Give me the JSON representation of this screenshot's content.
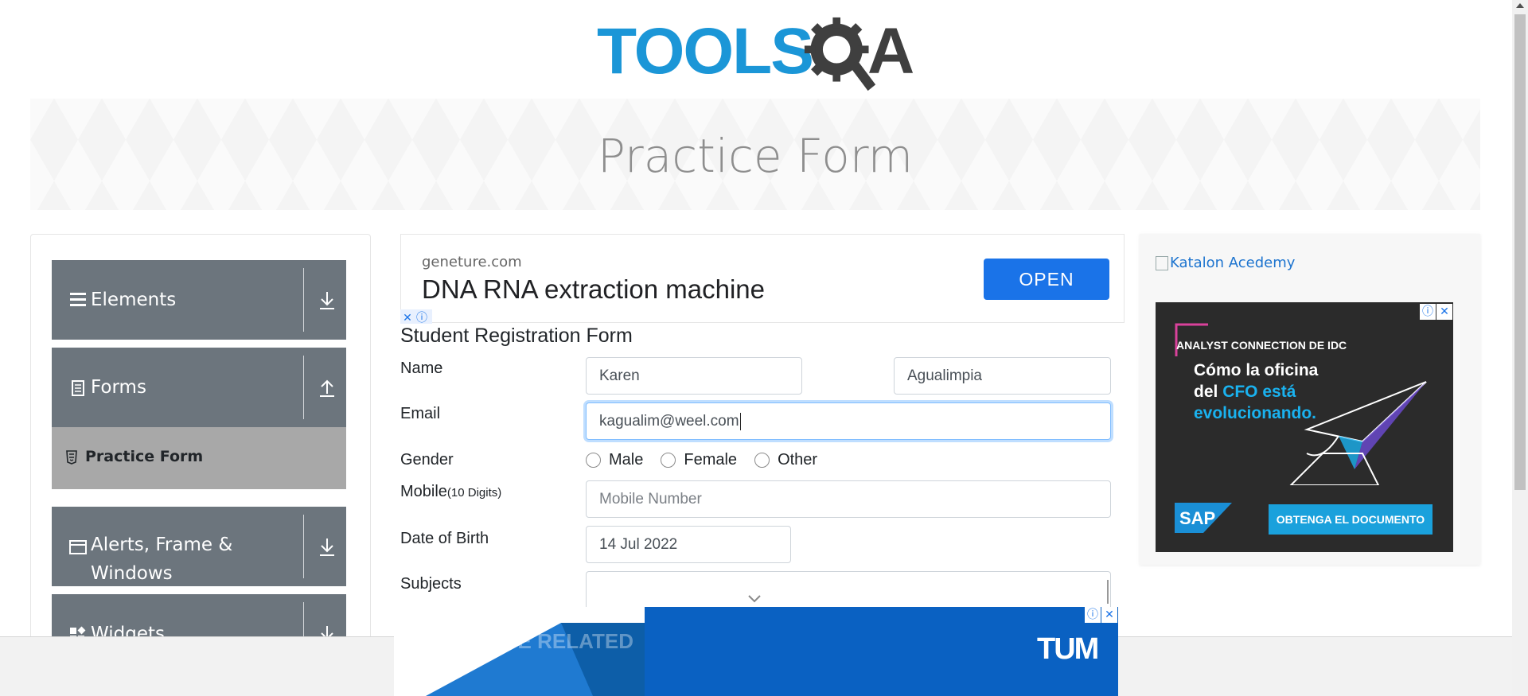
{
  "logo": {
    "brand_left": "TOOLS",
    "brand_right": "A"
  },
  "banner": {
    "title": "Practice Form"
  },
  "sidebar": {
    "groups": [
      {
        "label": "Elements",
        "icon": "menu-lines-icon",
        "arrow": "download-arrow-icon"
      },
      {
        "label": "Forms",
        "icon": "document-icon",
        "arrow": "upload-arrow-icon"
      },
      {
        "label": "Alerts, Frame & Windows",
        "icon": "window-icon",
        "arrow": "download-arrow-icon"
      },
      {
        "label": "Widgets",
        "icon": "widgets-icon",
        "arrow": "download-arrow-icon"
      }
    ],
    "active_item": {
      "label": "Practice Form",
      "icon": "html5-icon"
    }
  },
  "top_ad": {
    "domain": "geneture.com",
    "headline": "DNA RNA extraction machine",
    "cta": "OPEN",
    "badge_close": "✕",
    "badge_info": "ⓘ"
  },
  "form": {
    "title": "Student Registration Form",
    "name_label": "Name",
    "first_name_value": "Karen",
    "last_name_value": "Agualimpia",
    "email_label": "Email",
    "email_value": "kagualim@weel.com",
    "gender_label": "Gender",
    "gender_options": [
      "Male",
      "Female",
      "Other"
    ],
    "mobile_label": "Mobile",
    "mobile_hint": "(10 Digits)",
    "mobile_placeholder": "Mobile Number",
    "dob_label": "Date of Birth",
    "dob_value": "14 Jul 2022",
    "subjects_label": "Subjects"
  },
  "right_ad": {
    "link_text": "Katalon Acedemy",
    "overline": "ANALYST CONNECTION DE IDC",
    "line1": "Cómo la oficina",
    "line2_a": "del ",
    "line2_b": "CFO está",
    "line3": "evolucionando.",
    "brand": "SAP",
    "cta": "OBTENGA EL DOCUMENTO",
    "info": "ⓘ",
    "close": "✕"
  },
  "bottom_ad": {
    "overlay_text": "PRACTICE RELATED",
    "brand": "TUM",
    "info": "ⓘ",
    "close": "✕"
  },
  "colors": {
    "logo_blue": "#1b96d7",
    "logo_dark": "#3f3f3f",
    "sidebar_group": "#6c757d",
    "sidebar_active": "#a8a8a8",
    "ad_cta": "#1a73e8",
    "bottom_ad_blue": "#0a61c2"
  }
}
